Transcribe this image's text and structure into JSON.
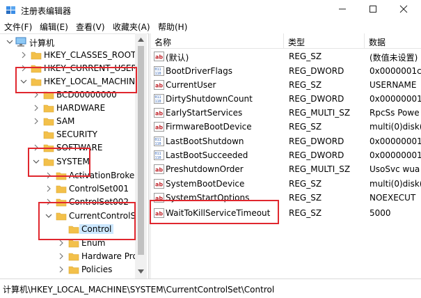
{
  "window": {
    "title": "注册表编辑器"
  },
  "menu": [
    {
      "label": "文件(F)"
    },
    {
      "label": "编辑(E)"
    },
    {
      "label": "查看(V)"
    },
    {
      "label": "收藏夹(A)"
    },
    {
      "label": "帮助(H)"
    }
  ],
  "tree": {
    "items": [
      {
        "label": "计算机",
        "expanded": true,
        "icon": "computer-icon"
      },
      {
        "label": "HKEY_CLASSES_ROOT",
        "expanded": false
      },
      {
        "label": "HKEY_CURRENT_USER",
        "expanded": false
      },
      {
        "label": "HKEY_LOCAL_MACHINE",
        "expanded": true
      },
      {
        "label": "BCD00000000",
        "expanded": false
      },
      {
        "label": "HARDWARE",
        "expanded": false
      },
      {
        "label": "SAM",
        "expanded": false
      },
      {
        "label": "SECURITY",
        "expanded": false
      },
      {
        "label": "SOFTWARE",
        "expanded": false
      },
      {
        "label": "SYSTEM",
        "expanded": true
      },
      {
        "label": "ActivationBroker",
        "expanded": false
      },
      {
        "label": "ControlSet001",
        "expanded": false
      },
      {
        "label": "ControlSet002",
        "expanded": false
      },
      {
        "label": "CurrentControlSe",
        "expanded": true
      },
      {
        "label": "Control",
        "selected": true
      },
      {
        "label": "Enum",
        "expanded": false
      },
      {
        "label": "Hardware Pro",
        "expanded": false
      },
      {
        "label": "Policies",
        "expanded": false
      }
    ]
  },
  "list": {
    "columns": [
      "名称",
      "类型",
      "数据"
    ],
    "rows": [
      {
        "name": "(默认)",
        "type": "REG_SZ",
        "data": "(数值未设置)",
        "icon": "string-value-icon"
      },
      {
        "name": "BootDriverFlags",
        "type": "REG_DWORD",
        "data": "0x0000001c",
        "icon": "binary-value-icon"
      },
      {
        "name": "CurrentUser",
        "type": "REG_SZ",
        "data": "USERNAME",
        "icon": "string-value-icon"
      },
      {
        "name": "DirtyShutdownCount",
        "type": "REG_DWORD",
        "data": "0x00000001",
        "icon": "binary-value-icon"
      },
      {
        "name": "EarlyStartServices",
        "type": "REG_MULTI_SZ",
        "data": "RpcSs Powe",
        "icon": "string-value-icon"
      },
      {
        "name": "FirmwareBootDevice",
        "type": "REG_SZ",
        "data": "multi(0)disk(",
        "icon": "string-value-icon"
      },
      {
        "name": "LastBootShutdown",
        "type": "REG_DWORD",
        "data": "0x00000001",
        "icon": "binary-value-icon"
      },
      {
        "name": "LastBootSucceeded",
        "type": "REG_DWORD",
        "data": "0x00000001",
        "icon": "binary-value-icon"
      },
      {
        "name": "PreshutdownOrder",
        "type": "REG_MULTI_SZ",
        "data": "UsoSvc wua",
        "icon": "string-value-icon"
      },
      {
        "name": "SystemBootDevice",
        "type": "REG_SZ",
        "data": "multi(0)disk(",
        "icon": "string-value-icon"
      },
      {
        "name": "SystemStartOptions",
        "type": "REG_SZ",
        "data": " NOEXECUT",
        "icon": "string-value-icon"
      },
      {
        "name": "WaitToKillServiceTimeout",
        "type": "REG_SZ",
        "data": "5000",
        "icon": "string-value-icon"
      }
    ]
  },
  "statusbar": {
    "path": "计算机\\HKEY_LOCAL_MACHINE\\SYSTEM\\CurrentControlSet\\Control"
  },
  "colors": {
    "highlight": "#e0272e",
    "folder": "#f3c04a",
    "selection": "#cce8ff"
  }
}
